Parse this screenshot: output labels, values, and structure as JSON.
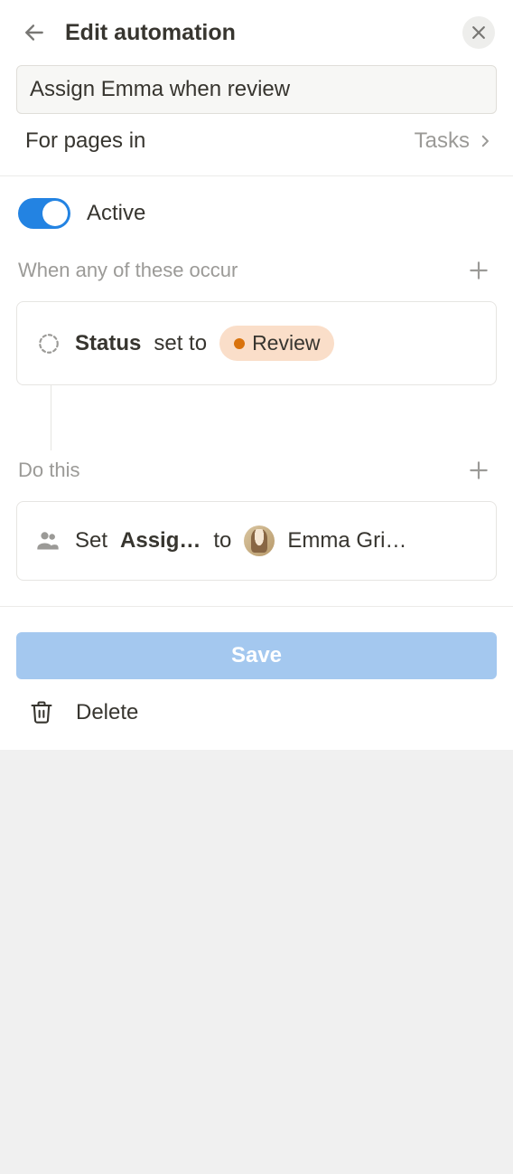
{
  "header": {
    "title": "Edit automation"
  },
  "nameInput": {
    "value": "Assign Emma when review"
  },
  "scope": {
    "label": "For pages in",
    "value": "Tasks"
  },
  "active": {
    "label": "Active",
    "on": true
  },
  "trigger": {
    "sectionLabel": "When any of these occur",
    "property": "Status",
    "verb": "set to",
    "statusPill": "Review",
    "statusColor": "#d9730d"
  },
  "action": {
    "sectionLabel": "Do this",
    "verb": "Set",
    "property": "Assig…",
    "to": "to",
    "assigneeName": "Emma Gri…"
  },
  "footer": {
    "save": "Save",
    "delete": "Delete"
  }
}
